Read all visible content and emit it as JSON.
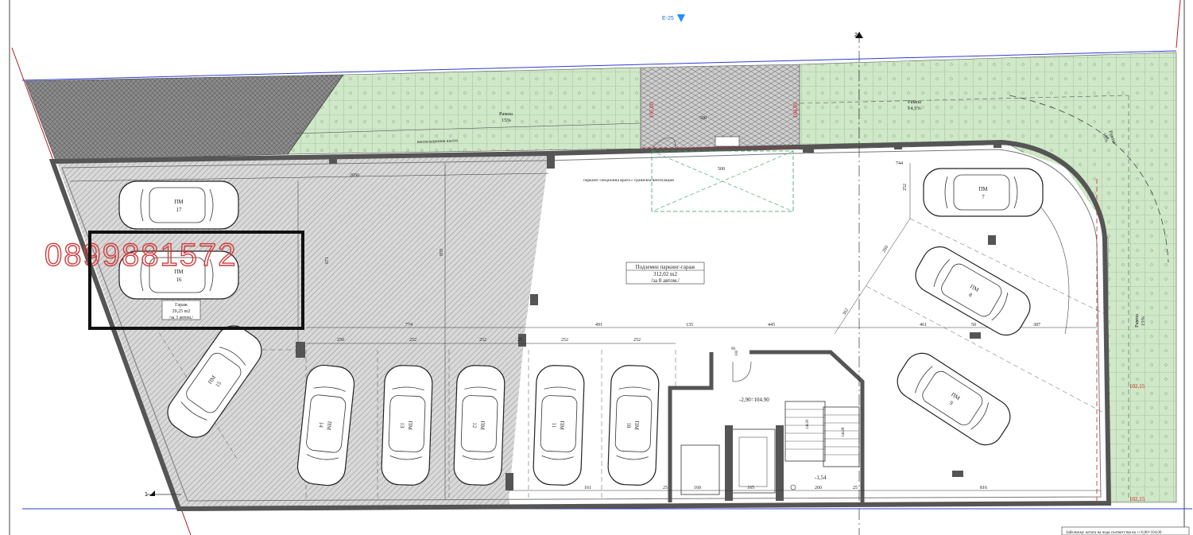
{
  "colors": {
    "grass": "#cfe8c8",
    "grass_grid": "#8aa080",
    "paving": "#cfcfcf",
    "hatch": "#bdbdbd",
    "wall": "#5a5a5a",
    "watermark": "#d23a3a",
    "level_marker": "#1e90ff",
    "highlight_box": "#111111"
  },
  "plan": {
    "top_marker": "E-25",
    "section_marker_top": "2",
    "section_marker_left": "1",
    "watermark": "0899881572",
    "main_label": {
      "title": "Подземен паркинг-гараж",
      "area": "312,02 m2",
      "capacity": "/за 8 автом./"
    },
    "garage_label": {
      "title": "Гараж",
      "area": "29,25 m2",
      "capacity": "/за 3 автом./"
    },
    "gate_note": "паркинг секционна врата с гранична вентилация",
    "ramps": [
      {
        "name": "Рампа",
        "slope": "15%"
      },
      {
        "name": "Рампа",
        "slope": "14,5%"
      },
      {
        "name": "Рампа",
        "slope": "15%"
      },
      {
        "name": "Рампа",
        "slope": "15%"
      }
    ],
    "ventilation_note": "вентилационна шахта",
    "levels": {
      "main": "-2,90=104.90",
      "stair": "-1,54",
      "red_left": "105,00",
      "red_right": "104,95",
      "red_corner": "102,15",
      "red_bottom": "102,15"
    },
    "parking_label": "ПМ",
    "parking_numbers": [
      "17",
      "16",
      "15",
      "14",
      "13",
      "12",
      "11",
      "10",
      "7",
      "8",
      "9"
    ],
    "dimensions": {
      "top_run": "2050",
      "gate_width": "500",
      "corner": "744",
      "corner_vertical": "252",
      "left_vertical": "671",
      "middle_vertical": "859",
      "diag_1": "260",
      "diag_2": "362",
      "row_774": "774",
      "row_491": "491",
      "row_135": "135",
      "row_445": "445",
      "row_461": "461",
      "row_50": "50",
      "row_387": "387",
      "bay_1": "250",
      "bay_2": "252",
      "bay_3": "252",
      "bay_4": "252",
      "bay_5": "252",
      "gap_25": "25",
      "bottom_1": "161",
      "bottom_2": "25",
      "bottom_3": "160",
      "bottom_4": "165",
      "bottom_5": "260",
      "bottom_6": "25",
      "bottom_7": "816",
      "door_1": "90",
      "door_2": "100",
      "stair_1": "14x20",
      "stair_2": "14x28"
    },
    "footer_note": "Забележка: котата на пода съответства на +/-0,00=104,00"
  }
}
